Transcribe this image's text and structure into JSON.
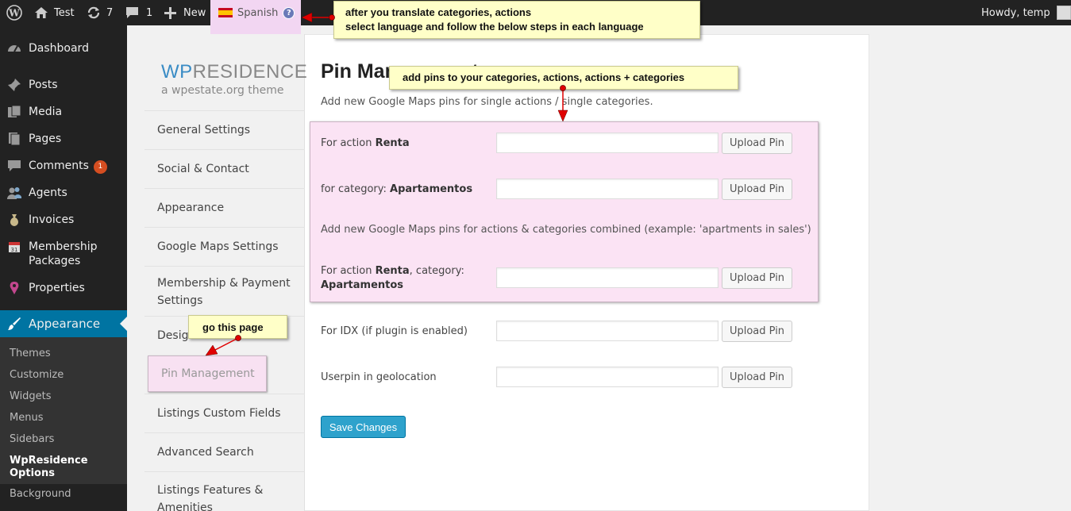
{
  "adminbar": {
    "site_name": "Test",
    "updates_count": "7",
    "comments_count": "1",
    "new_label": "New",
    "language_label": "Spanish",
    "language_help": "?",
    "greeting": "Howdy, temp"
  },
  "menu": {
    "items": [
      {
        "label": "Dashboard",
        "icon": "dashboard-icon"
      },
      {
        "label": "Posts",
        "icon": "pin-icon"
      },
      {
        "label": "Media",
        "icon": "media-icon"
      },
      {
        "label": "Pages",
        "icon": "pages-icon"
      },
      {
        "label": "Comments",
        "icon": "comments-icon",
        "badge": "1"
      },
      {
        "label": "Agents",
        "icon": "agents-icon"
      },
      {
        "label": "Invoices",
        "icon": "money-bag-icon"
      },
      {
        "label": "Membership Packages",
        "icon": "calendar-icon"
      },
      {
        "label": "Properties",
        "icon": "map-marker-icon"
      },
      {
        "label": "Appearance",
        "icon": "brush-icon"
      }
    ],
    "submenu": [
      "Themes",
      "Customize",
      "Widgets",
      "Menus",
      "Sidebars",
      "WpResidence Options",
      "Background"
    ]
  },
  "options": {
    "logo_brand_a": "WP",
    "logo_brand_b": "RESIDENCE",
    "logo_tagline": "a wpestate.org theme",
    "tabs": [
      "General Settings",
      "Social & Contact",
      "Appearance",
      "Google Maps Settings",
      "Membership & Payment Settings",
      "Design",
      "Pin Management",
      "Listings Custom Fields",
      "Advanced Search",
      "Listings Features & Amenities"
    ],
    "active_tab": "Pin Management"
  },
  "main": {
    "title": "Pin Management",
    "desc_single": "Add new Google Maps pins for single actions / single categories.",
    "desc_combined": "Add new Google Maps pins for actions & categories combined (example: 'apartments in sales')",
    "rows": [
      {
        "prefix": "For action ",
        "bold": "Renta",
        "suffix": "",
        "value": "",
        "button": "Upload Pin"
      },
      {
        "prefix": "for category: ",
        "bold": "Apartamentos",
        "suffix": "",
        "value": "",
        "button": "Upload Pin"
      },
      {
        "prefix": "For action ",
        "bold": "Renta",
        "suffix": ", category:",
        "bold2": "Apartamentos",
        "value": "",
        "button": "Upload Pin"
      },
      {
        "prefix": "For IDX (if plugin is enabled)",
        "value": "",
        "button": "Upload Pin"
      },
      {
        "prefix": "Userpin in geolocation",
        "value": "",
        "button": "Upload Pin"
      }
    ],
    "save_label": "Save Changes"
  },
  "annotations": {
    "top_line1": "after you translate categories, actions",
    "top_line2": "select language and follow the below steps in each language",
    "pins_note": "add pins to your categories, actions, actions + categories",
    "go_note": "go this page"
  },
  "colors": {
    "adminbar": "#222222",
    "menu_current": "#0074a2",
    "highlight_pink": "#fbe3f4",
    "callout_yellow": "#ffffc8",
    "arrow_red": "#e00000",
    "save_button": "#2ea2cc"
  }
}
